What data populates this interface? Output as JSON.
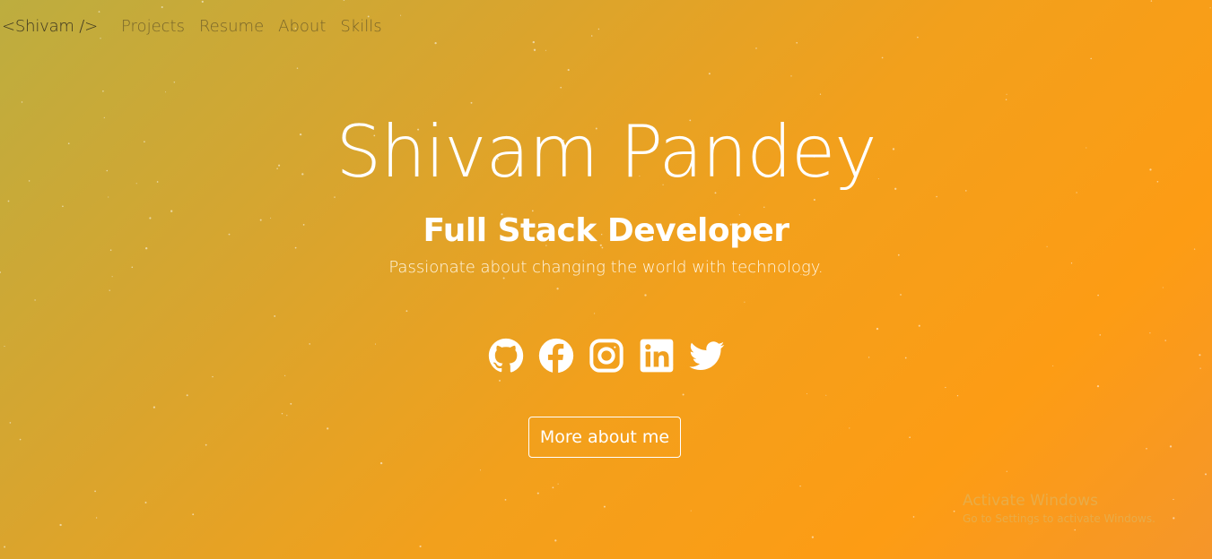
{
  "nav": {
    "brand": "<Shivam />",
    "links": [
      "Projects",
      "Resume",
      "About",
      "Skills"
    ]
  },
  "hero": {
    "name": "Shivam Pandey",
    "role": "Full Stack Developer",
    "tagline": "Passionate about changing the world with technology.",
    "socials": [
      {
        "icon": "github-icon",
        "label": "GitHub"
      },
      {
        "icon": "facebook-icon",
        "label": "Facebook"
      },
      {
        "icon": "instagram-icon",
        "label": "Instagram"
      },
      {
        "icon": "linkedin-icon",
        "label": "LinkedIn"
      },
      {
        "icon": "twitter-icon",
        "label": "Twitter"
      }
    ],
    "cta_label": "More about me"
  },
  "watermark": {
    "title": "Activate Windows",
    "subtitle": "Go to Settings to activate Windows."
  },
  "colors": {
    "gradient_start": "#bdad3f",
    "gradient_end": "#fd9c14",
    "text": "#ffffff"
  }
}
